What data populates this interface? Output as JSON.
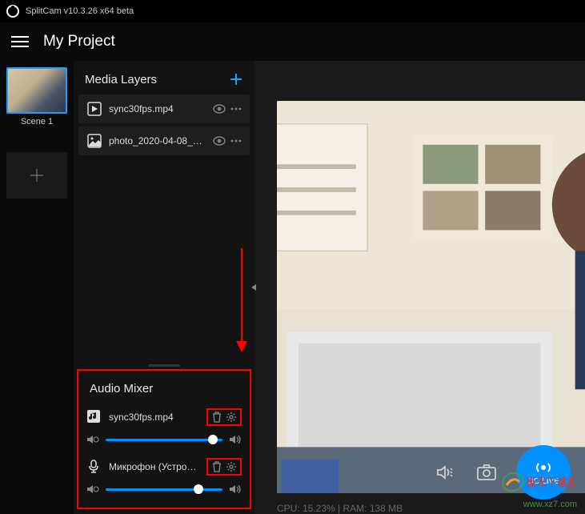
{
  "titlebar": {
    "title": "SplitCam v10.3.26 x64 beta"
  },
  "header": {
    "project": "My Project"
  },
  "scenes": {
    "items": [
      {
        "label": "Scene 1",
        "active": true
      }
    ]
  },
  "media_layers": {
    "title": "Media Layers",
    "items": [
      {
        "name": "sync30fps.mp4",
        "type": "video"
      },
      {
        "name": "photo_2020-04-08_12...",
        "type": "image"
      }
    ]
  },
  "audio_mixer": {
    "title": "Audio Mixer",
    "items": [
      {
        "name": "sync30fps.mp4",
        "type": "file",
        "volume": 88
      },
      {
        "name": "Микрофон (Устройст...",
        "type": "mic",
        "volume": 75
      }
    ]
  },
  "preview": {
    "stats": "CPU: 15.23% | RAM: 138 MB"
  },
  "controls": {
    "go_live": "GO LIVE"
  },
  "watermark": {
    "url": "www.xz7.com",
    "brand": "极光下载站"
  }
}
